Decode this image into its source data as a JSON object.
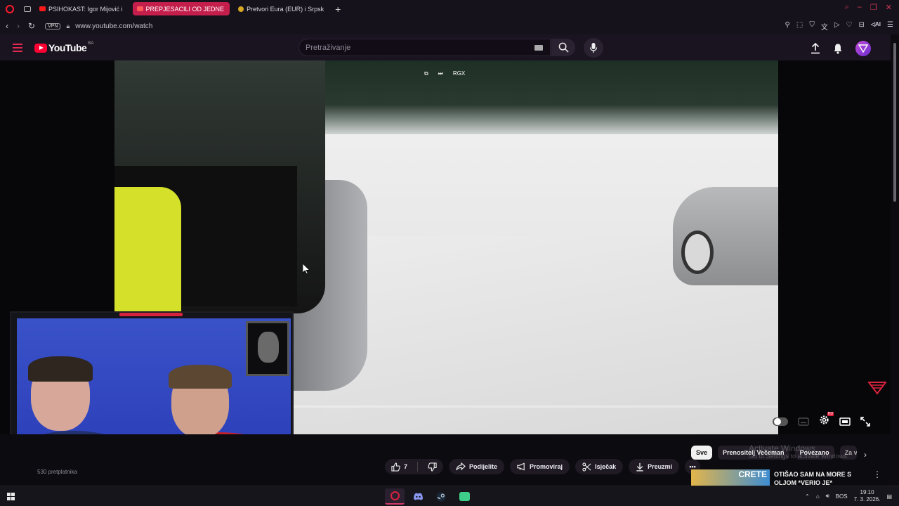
{
  "browser": {
    "tabs": [
      {
        "label": "PSIHOKAST: Igor Mijović i",
        "active": false,
        "favicon": "youtube-icon"
      },
      {
        "label": "PREPJESACILI OD JEDNE",
        "active": true,
        "favicon": "youtube-icon"
      },
      {
        "label": "Pretvori Eura (EUR) i Srpsk",
        "active": false,
        "favicon": "coin-icon"
      }
    ],
    "url": "www.youtube.com/watch",
    "vpn_label": "VPN",
    "ai_label": "AI",
    "accent": "#c41e4d"
  },
  "youtube": {
    "logo_text": "YouTube",
    "country_code": "BA",
    "search_placeholder": "Pretraživanje"
  },
  "player": {
    "speed_label": "RGX",
    "progress": 0.0
  },
  "channel": {
    "subscribers": "530 pretplatnika"
  },
  "actions": {
    "like_count": "7",
    "share": "Podijelite",
    "promote": "Promoviraj",
    "clip": "Isječak",
    "download": "Preuzmi"
  },
  "chips": {
    "all": "Sve",
    "streamer": "Prenositelj Večeman",
    "related": "Povezano",
    "cut": "Za v"
  },
  "watermark": {
    "title": "Activate Windows",
    "subtitle": "Go to Settings to activate Windows."
  },
  "recommendation": {
    "thumb_text": "CRETE",
    "title": "OTIŠAO SAM NA MORE S OLJOM *VERIO JE*"
  },
  "taskbar": {
    "language": "BOS",
    "time": "19:10",
    "date": "7. 3. 2026."
  }
}
